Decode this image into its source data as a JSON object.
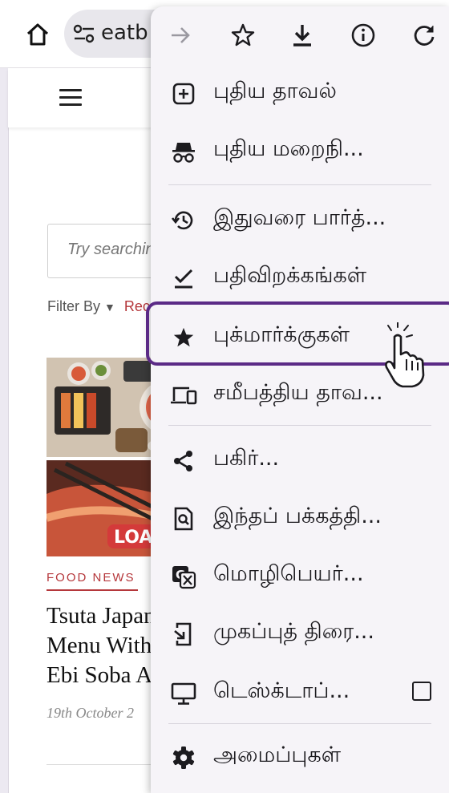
{
  "browser": {
    "url_text": "eatbook.sg",
    "home_icon": "home-icon",
    "site_info_icon": "tune-icon"
  },
  "page": {
    "search_placeholder": "Try searching",
    "filter_label": "Filter By",
    "filter_value": "Recent",
    "article": {
      "category": "FOOD NEWS",
      "title_lines": [
        "Tsuta Japanese",
        "Menu With",
        "Ebi Soba And"
      ],
      "date": "19th October 2"
    },
    "thumbnail_badge": "LOA"
  },
  "menu": {
    "toolbar_icons": [
      "forward-icon",
      "bookmark-star-icon",
      "download-icon",
      "info-icon",
      "refresh-icon"
    ],
    "items": [
      {
        "label": "புதிய தாவல்",
        "icon": "new-tab-icon"
      },
      {
        "label": "புதிய மறைநி...",
        "icon": "incognito-icon"
      },
      {
        "label": "இதுவரை பார்த்...",
        "icon": "history-icon"
      },
      {
        "label": "பதிவிறக்கங்கள்",
        "icon": "downloads-check-icon"
      },
      {
        "label": "புக்மார்க்குகள்",
        "icon": "bookmarks-star-icon"
      },
      {
        "label": "சமீபத்திய தாவ...",
        "icon": "recent-tabs-icon"
      },
      {
        "label": "பகிர்...",
        "icon": "share-icon"
      },
      {
        "label": "இந்தப் பக்கத்தி...",
        "icon": "find-in-page-icon"
      },
      {
        "label": "மொழிபெயர்...",
        "icon": "translate-icon"
      },
      {
        "label": "முகப்புத் திரை...",
        "icon": "add-to-home-screen-icon"
      },
      {
        "label": "டெஸ்க்டாப்...",
        "icon": "desktop-site-icon"
      },
      {
        "label": "அமைப்புகள்",
        "icon": "settings-gear-icon"
      }
    ]
  },
  "colors": {
    "accent_red": "#b5373b",
    "highlight_purple": "#5b2a86",
    "menu_bg": "#f6f4f8"
  }
}
